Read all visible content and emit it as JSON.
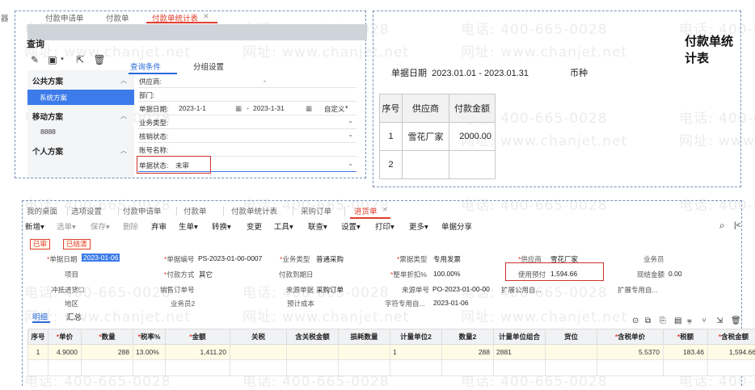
{
  "watermark": {
    "phone": "电话: 400-665-0028",
    "site": "网址: www.chanjet.net"
  },
  "query_panel": {
    "tabs": [
      "器",
      "付款申请单",
      "付款单",
      "付款单统计表"
    ],
    "title": "查询",
    "left": {
      "public_label": "公共方案",
      "system_scheme": "系统方案",
      "mobile_label": "移动方案",
      "mobile_sub": "8888",
      "personal_label": "个人方案"
    },
    "right_tabs": [
      "查询条件",
      "分组设置"
    ],
    "fields": {
      "supplier": "供应商:",
      "supplier_value": "-",
      "dept": "部门:",
      "doc_date": "单据日期:",
      "date_from": "2023-1-1",
      "date_sep": "-",
      "date_to": "2023-1-31",
      "date_mode": "自定义",
      "biz_type": "业务类型:",
      "writeoff": "核销状态:",
      "account": "账号名称:",
      "status": "单据状态:",
      "status_value": "未审"
    }
  },
  "report_panel": {
    "title": "付款单统计表",
    "date_label": "单据日期",
    "date_range": "2023.01.01 - 2023.01.31",
    "currency_label": "币种",
    "headers": [
      "序号",
      "供应商",
      "付款金额"
    ],
    "rows": [
      {
        "no": "1",
        "supplier": "雪花厂家",
        "amount": "2000.00"
      },
      {
        "no": "2",
        "supplier": "",
        "amount": ""
      }
    ]
  },
  "purchase_panel": {
    "tabs": [
      "我的桌面",
      "选项设置",
      "付款申请单",
      "付款单",
      "付款单统计表",
      "采购订单",
      "进货单"
    ],
    "toolbar": [
      "新增",
      "选单",
      "保存",
      "删除",
      "弃审",
      "生单",
      "转换",
      "变更",
      "工具",
      "联查",
      "设置",
      "打印",
      "更多",
      "单据分享"
    ],
    "badges": [
      "已审",
      "已结清"
    ],
    "form": {
      "doc_date_label": "单据日期",
      "doc_date": "2023-01-06",
      "doc_no_label": "单据编号",
      "doc_no": "PS-2023-01-00-0007",
      "biz_type_label": "业务类型",
      "biz_type": "普通采购",
      "invoice_type_label": "票据类型",
      "invoice_type": "专用发票",
      "supplier_label": "供应商",
      "supplier": "雪花厂家",
      "salesman_label": "业务员",
      "project_label": "项目",
      "pay_method_label": "付款方式",
      "pay_method": "其它",
      "pay_due_label": "付款到期日",
      "discount_label": "整单折扣%",
      "discount": "100.00%",
      "prepay_label": "使用预付",
      "prepay": "1,594.66",
      "cash_label": "现结金额",
      "cash": "0.00",
      "redflush_label": "冲抵进货",
      "sales_order_label": "销售订单号",
      "source_doc_label": "来源单据",
      "source_doc": "采购订单",
      "source_no_label": "来源单号",
      "source_no": "PO-2023-01-00-00",
      "ext_public_label": "扩展公用自...",
      "ext_special_label": "扩展专用自...",
      "region_label": "地区",
      "salesman2_label": "业务员2",
      "est_cost_label": "预计成本",
      "field_special_label": "字符专用自...",
      "field_special": "2023-01-06"
    },
    "detail_tabs": [
      "明细",
      "汇总"
    ],
    "grid_headers": [
      "序号",
      "单价",
      "数量",
      "税率%",
      "金额",
      "关税",
      "含关税金额",
      "损耗数量",
      "计量单位2",
      "数量2",
      "计量单位组合",
      "货位",
      "含税单价",
      "税额",
      "含税金额"
    ],
    "grid_required": [
      false,
      true,
      true,
      true,
      true,
      false,
      false,
      false,
      false,
      false,
      false,
      false,
      true,
      true,
      true
    ],
    "grid_row": [
      "1",
      "4.9000",
      "288",
      "13.00%",
      "1,411.20",
      "",
      "",
      "",
      "1",
      "288",
      "2881",
      "",
      "5.5370",
      "183.46",
      "1,594.66"
    ]
  }
}
